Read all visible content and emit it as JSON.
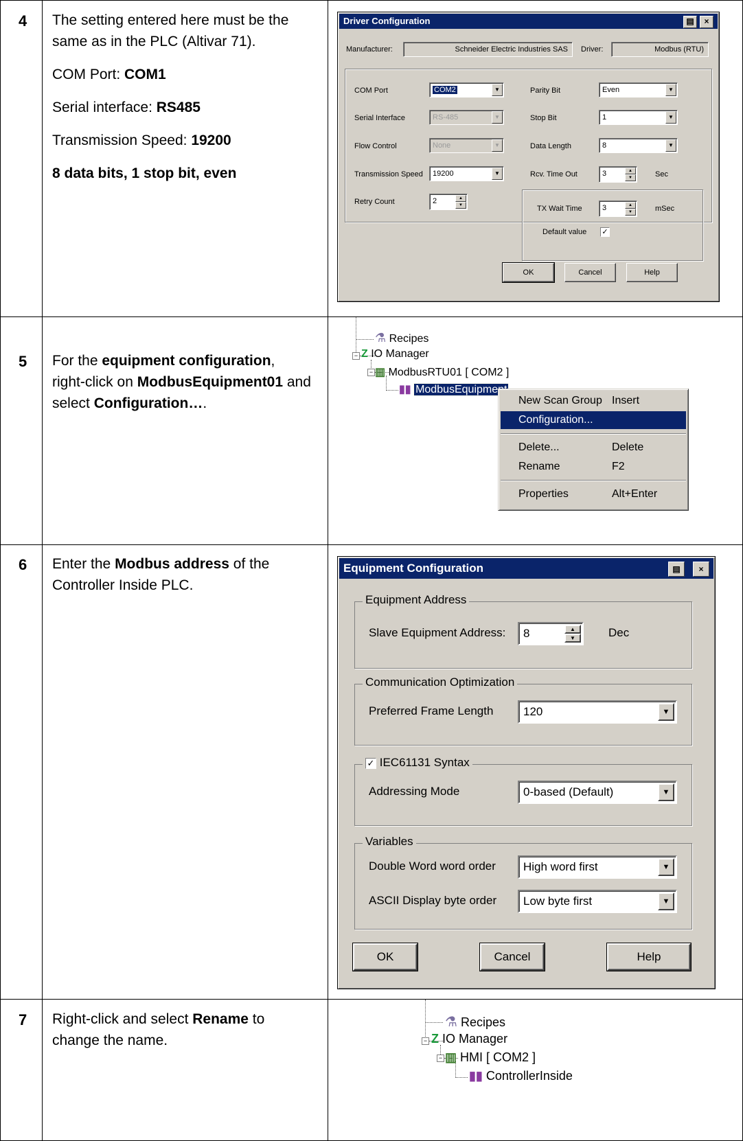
{
  "steps": [
    {
      "num": "4"
    },
    {
      "num": "5"
    },
    {
      "num": "6"
    },
    {
      "num": "7"
    }
  ],
  "step4": {
    "text1": "The setting entered here must be the same as in the PLC (Altivar 71).",
    "com_port_label": "COM Port: ",
    "com_port_value": "COM1",
    "serial_label": "Serial interface: ",
    "serial_value": "RS485",
    "speed_label": "Transmission Speed: ",
    "speed_value": "19200",
    "bits": "8 data bits, 1 stop bit, even"
  },
  "step5": {
    "t1": "For the ",
    "b1": "equipment configuration",
    "t2": ", right-click on ",
    "b2": "ModbusEquipment01",
    "t3": " and select ",
    "b3": "Configuration…",
    "t4": "."
  },
  "step6": {
    "t1": "Enter the ",
    "b1": "Modbus address",
    "t2": " of the Controller Inside PLC."
  },
  "step7": {
    "t1": "Right-click and select ",
    "b1": "Rename",
    "t2": " to change the name."
  },
  "driver_dialog": {
    "title": "Driver Configuration",
    "manufacturer_label": "Manufacturer:",
    "manufacturer_value": "Schneider Electric Industries SAS",
    "driver_label": "Driver:",
    "driver_value": "Modbus (RTU)",
    "com_port_label": "COM Port",
    "com_port_value": "COM2",
    "serial_label": "Serial Interface",
    "serial_value": "RS-485",
    "flow_label": "Flow Control",
    "flow_value": "None",
    "speed_label": "Transmission Speed",
    "speed_value": "19200",
    "retry_label": "Retry Count",
    "retry_value": "2",
    "parity_label": "Parity Bit",
    "parity_value": "Even",
    "stop_label": "Stop Bit",
    "stop_value": "1",
    "datalen_label": "Data Length",
    "datalen_value": "8",
    "rcv_label": "Rcv. Time Out",
    "rcv_value": "3",
    "rcv_unit": "Sec",
    "txwait_label": "TX Wait Time",
    "txwait_value": "3",
    "txwait_unit": "mSec",
    "default_label": "Default value",
    "ok": "OK",
    "cancel": "Cancel",
    "help": "Help"
  },
  "tree1": {
    "recipes": "Recipes",
    "io_manager": "IO Manager",
    "port": "ModbusRTU01 [ COM2 ]",
    "equipment": "ModbusEquipment"
  },
  "context_menu": [
    {
      "label": "New Scan Group",
      "shortcut": "Insert"
    },
    {
      "label": "Configuration...",
      "shortcut": ""
    },
    {
      "label": "Delete...",
      "shortcut": "Delete"
    },
    {
      "label": "Rename",
      "shortcut": "F2"
    },
    {
      "label": "Properties",
      "shortcut": "Alt+Enter"
    }
  ],
  "equip_dialog": {
    "title": "Equipment Configuration",
    "group_address": "Equipment Address",
    "slave_label": "Slave Equipment Address:",
    "slave_value": "8",
    "slave_unit": "Dec",
    "group_comm": "Communication Optimization",
    "frame_label": "Preferred Frame Length",
    "frame_value": "120",
    "iec_label": "IEC61131 Syntax",
    "addr_mode_label": "Addressing Mode",
    "addr_mode_value": "0-based (Default)",
    "group_vars": "Variables",
    "dword_label": "Double Word word order",
    "dword_value": "High word first",
    "ascii_label": "ASCII Display byte order",
    "ascii_value": "Low byte first",
    "ok": "OK",
    "cancel": "Cancel",
    "help": "Help"
  },
  "tree2": {
    "recipes": "Recipes",
    "io_manager": "IO Manager",
    "port": "HMI [ COM2 ]",
    "equipment": "ControllerInside"
  }
}
